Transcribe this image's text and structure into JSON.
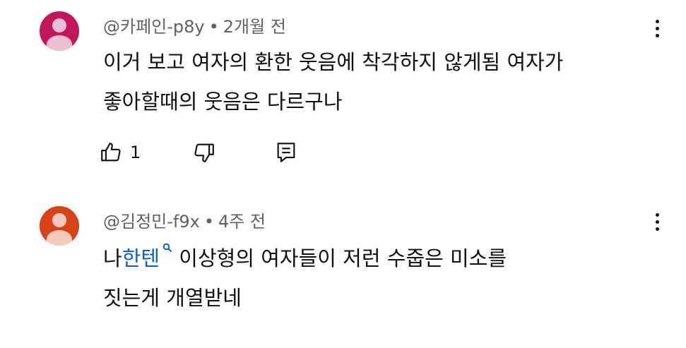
{
  "comments": [
    {
      "author": "@카페인-p8y",
      "time": "2개월 전",
      "lines": [
        "이거 보고 여자의 환한 웃음에 착각하지 않게됨 여자가",
        "좋아할때의 웃음은 다르구나"
      ],
      "like_count": "1",
      "avatar_color": "#c2185b"
    },
    {
      "author": "@김정민-f9x",
      "time": "4주 전",
      "line1_before": "나",
      "line1_link": "한텐",
      "line1_after": " 이상형의 여자들이 저런 수줍은 미소를",
      "line2": "짓는게 개열받네",
      "avatar_color": "#d84315"
    }
  ],
  "separator": "•",
  "icons": {
    "like": "thumbs-up-icon",
    "dislike": "thumbs-down-icon",
    "reply": "reply-comment-icon",
    "more": "vertical-dots-icon",
    "search": "search-icon"
  },
  "colors": {
    "link": "#065fd4",
    "meta": "#606060",
    "text": "#0f0f0f"
  }
}
